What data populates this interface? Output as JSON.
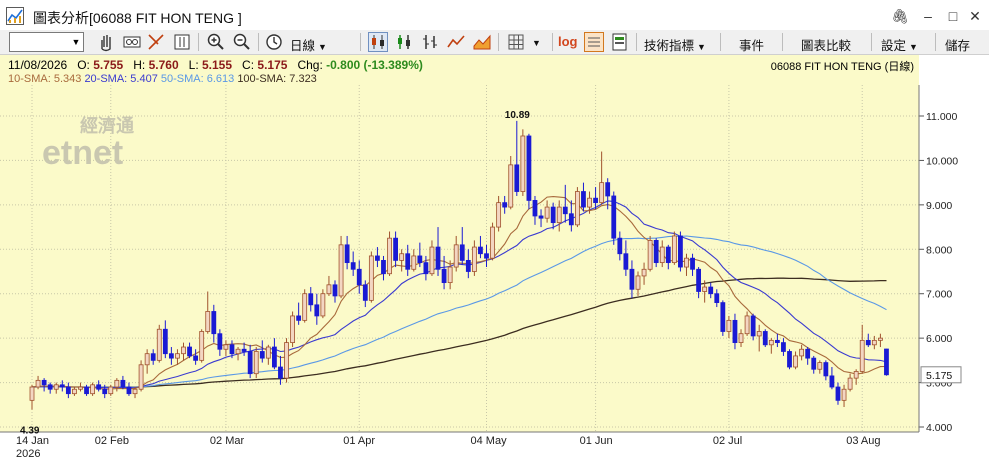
{
  "window": {
    "title": "圖表分析[06088 FIT HON TENG ]",
    "controls": [
      "pin-icon",
      "minimize-icon",
      "restore-icon",
      "close-icon"
    ]
  },
  "toolbar": {
    "period_label": "日線",
    "indicators_label": "技術指標",
    "events_label": "事件",
    "compare_label": "圖表比較",
    "settings_label": "設定",
    "save_label": "儲存",
    "log_label": "log",
    "icons": [
      "hand-icon",
      "crosshair-icon",
      "draw-line-icon",
      "bar-select-icon",
      "zoom-in-icon",
      "zoom-out-icon",
      "clock-icon",
      "candlestick-icon",
      "ohlc-bar-icon",
      "hlc-bar-icon",
      "line-chart-icon",
      "area-chart-icon",
      "grid-icon",
      "log-scale-icon",
      "fit-icon",
      "export-icon"
    ]
  },
  "info": {
    "date": "11/08/2026",
    "o_label": "O:",
    "o": "5.755",
    "h_label": "H:",
    "h": "5.760",
    "l_label": "L:",
    "l": "5.155",
    "c_label": "C:",
    "c": "5.175",
    "chg_label": "Chg:",
    "chg": "-0.800 (-13.389%)",
    "name": "06088  FIT HON TENG (日線)",
    "sma10": "10-SMA: 5.343",
    "sma20": "20-SMA: 5.407",
    "sma50": "50-SMA: 6.613",
    "sma100": "100-SMA: 7.323"
  },
  "colors": {
    "background": "#fbfac9",
    "up": "#f3d6c2",
    "up_border": "#a0522d",
    "down": "#1a1ad4",
    "sma10": "#a86a3c",
    "sma20": "#3a3ad0",
    "sma50": "#5a98e6",
    "sma100": "#3c2d20",
    "chg": "#2e8b1e",
    "price": "#8b1a1a"
  },
  "watermark": {
    "line1": "經濟通",
    "line2": "etnet"
  },
  "chart_data": {
    "type": "candlestick",
    "y_axis": {
      "min": 4.0,
      "max": 11.0,
      "ticks": [
        "4.000",
        "5.000",
        "6.000",
        "7.000",
        "8.000",
        "9.000",
        "10.000",
        "11.000"
      ]
    },
    "x_labels": [
      {
        "label": "14 Jan",
        "sub": "2026",
        "index": 0
      },
      {
        "label": "02 Feb",
        "index": 13
      },
      {
        "label": "02 Mar",
        "index": 32
      },
      {
        "label": "01 Apr",
        "index": 54
      },
      {
        "label": "04 May",
        "index": 75
      },
      {
        "label": "01 Jun",
        "index": 93
      },
      {
        "label": "02 Jul",
        "index": 115
      },
      {
        "label": "03 Aug",
        "index": 137
      }
    ],
    "annotations": [
      {
        "text": "10.89",
        "index": 80,
        "value": 10.89
      },
      {
        "text": "4.39",
        "index": 0,
        "value": 4.39
      }
    ],
    "last_price": "5.175",
    "candles": [
      [
        4.6,
        4.95,
        4.39,
        4.9
      ],
      [
        4.9,
        5.15,
        4.85,
        5.05
      ],
      [
        5.05,
        5.1,
        4.8,
        4.95
      ],
      [
        4.95,
        5.0,
        4.75,
        4.85
      ],
      [
        4.85,
        5.0,
        4.75,
        4.95
      ],
      [
        4.95,
        5.05,
        4.8,
        4.9
      ],
      [
        4.9,
        5.0,
        4.65,
        4.75
      ],
      [
        4.75,
        4.9,
        4.7,
        4.85
      ],
      [
        4.85,
        5.0,
        4.8,
        4.9
      ],
      [
        4.9,
        4.95,
        4.7,
        4.75
      ],
      [
        4.75,
        5.0,
        4.7,
        4.95
      ],
      [
        4.95,
        5.05,
        4.8,
        4.85
      ],
      [
        4.85,
        4.95,
        4.65,
        4.75
      ],
      [
        4.75,
        4.95,
        4.7,
        4.9
      ],
      [
        4.9,
        5.1,
        4.8,
        5.05
      ],
      [
        5.05,
        5.15,
        4.85,
        4.9
      ],
      [
        4.9,
        5.0,
        4.7,
        4.75
      ],
      [
        4.75,
        4.9,
        4.65,
        4.85
      ],
      [
        4.85,
        5.5,
        4.8,
        5.4
      ],
      [
        5.4,
        5.75,
        5.2,
        5.65
      ],
      [
        5.65,
        5.75,
        5.4,
        5.5
      ],
      [
        5.5,
        6.3,
        5.45,
        6.2
      ],
      [
        6.2,
        6.4,
        5.55,
        5.65
      ],
      [
        5.65,
        5.8,
        5.4,
        5.55
      ],
      [
        5.55,
        5.75,
        5.4,
        5.65
      ],
      [
        5.65,
        5.9,
        5.5,
        5.8
      ],
      [
        5.8,
        5.9,
        5.55,
        5.6
      ],
      [
        5.6,
        5.75,
        5.4,
        5.5
      ],
      [
        5.5,
        6.2,
        5.45,
        6.15
      ],
      [
        6.15,
        7.05,
        6.1,
        6.6
      ],
      [
        6.6,
        6.75,
        5.9,
        6.1
      ],
      [
        6.1,
        6.2,
        5.6,
        5.75
      ],
      [
        5.75,
        5.95,
        5.6,
        5.85
      ],
      [
        5.85,
        5.95,
        5.55,
        5.65
      ],
      [
        5.65,
        5.8,
        5.5,
        5.75
      ],
      [
        5.75,
        5.9,
        5.6,
        5.7
      ],
      [
        5.7,
        5.85,
        5.1,
        5.2
      ],
      [
        5.2,
        5.8,
        5.1,
        5.7
      ],
      [
        5.7,
        5.95,
        5.45,
        5.55
      ],
      [
        5.55,
        5.85,
        5.4,
        5.8
      ],
      [
        5.8,
        6.0,
        5.3,
        5.35
      ],
      [
        5.35,
        5.6,
        4.95,
        5.1
      ],
      [
        5.1,
        6.0,
        5.0,
        5.9
      ],
      [
        5.9,
        6.6,
        5.8,
        6.5
      ],
      [
        6.5,
        6.8,
        6.3,
        6.4
      ],
      [
        6.4,
        7.1,
        6.35,
        7.0
      ],
      [
        7.0,
        7.15,
        6.6,
        6.75
      ],
      [
        6.75,
        7.0,
        6.3,
        6.5
      ],
      [
        6.5,
        7.1,
        6.45,
        7.0
      ],
      [
        7.0,
        7.4,
        6.95,
        7.2
      ],
      [
        7.2,
        7.3,
        6.8,
        6.95
      ],
      [
        6.95,
        8.3,
        6.9,
        8.1
      ],
      [
        8.1,
        8.3,
        7.55,
        7.7
      ],
      [
        7.7,
        7.95,
        7.4,
        7.55
      ],
      [
        7.55,
        7.75,
        7.0,
        7.2
      ],
      [
        7.2,
        7.3,
        6.7,
        6.85
      ],
      [
        6.85,
        7.95,
        6.8,
        7.85
      ],
      [
        7.85,
        8.05,
        7.6,
        7.75
      ],
      [
        7.75,
        7.85,
        7.3,
        7.45
      ],
      [
        7.45,
        8.4,
        7.4,
        8.25
      ],
      [
        8.25,
        8.4,
        7.6,
        7.75
      ],
      [
        7.75,
        8.0,
        7.5,
        7.9
      ],
      [
        7.9,
        8.1,
        7.4,
        7.55
      ],
      [
        7.55,
        8.0,
        7.5,
        7.85
      ],
      [
        7.85,
        8.15,
        7.6,
        7.7
      ],
      [
        7.7,
        7.85,
        7.3,
        7.45
      ],
      [
        7.45,
        8.2,
        7.4,
        8.05
      ],
      [
        8.05,
        8.5,
        7.4,
        7.55
      ],
      [
        7.55,
        7.85,
        7.1,
        7.25
      ],
      [
        7.25,
        7.75,
        7.1,
        7.6
      ],
      [
        7.6,
        8.3,
        7.5,
        8.1
      ],
      [
        8.1,
        8.5,
        7.65,
        7.75
      ],
      [
        7.75,
        8.0,
        7.35,
        7.5
      ],
      [
        7.5,
        8.2,
        7.4,
        8.05
      ],
      [
        8.05,
        8.3,
        7.8,
        7.9
      ],
      [
        7.9,
        8.1,
        7.6,
        7.8
      ],
      [
        7.8,
        8.6,
        7.75,
        8.5
      ],
      [
        8.5,
        9.2,
        8.4,
        9.05
      ],
      [
        9.05,
        9.2,
        8.8,
        8.95
      ],
      [
        8.95,
        10.1,
        8.9,
        9.9
      ],
      [
        9.9,
        10.89,
        9.2,
        9.3
      ],
      [
        9.3,
        10.7,
        9.2,
        10.55
      ],
      [
        10.55,
        10.6,
        8.9,
        9.1
      ],
      [
        9.1,
        9.2,
        8.55,
        8.75
      ],
      [
        8.75,
        8.9,
        8.5,
        8.7
      ],
      [
        8.7,
        9.1,
        8.6,
        8.95
      ],
      [
        8.95,
        9.05,
        8.45,
        8.6
      ],
      [
        8.6,
        9.1,
        8.4,
        8.95
      ],
      [
        8.95,
        9.45,
        8.6,
        8.8
      ],
      [
        8.8,
        9.1,
        8.4,
        8.55
      ],
      [
        8.55,
        9.4,
        8.5,
        9.3
      ],
      [
        9.3,
        9.5,
        8.85,
        8.95
      ],
      [
        8.95,
        9.3,
        8.8,
        9.15
      ],
      [
        9.15,
        9.4,
        8.9,
        9.05
      ],
      [
        9.05,
        10.2,
        9.0,
        9.5
      ],
      [
        9.5,
        9.6,
        8.9,
        9.2
      ],
      [
        9.2,
        9.3,
        8.1,
        8.25
      ],
      [
        8.25,
        8.4,
        7.75,
        7.9
      ],
      [
        7.9,
        8.2,
        7.4,
        7.55
      ],
      [
        7.55,
        7.75,
        6.9,
        7.1
      ],
      [
        7.1,
        7.5,
        6.95,
        7.4
      ],
      [
        7.4,
        7.7,
        7.2,
        7.55
      ],
      [
        7.55,
        8.3,
        7.5,
        8.2
      ],
      [
        8.2,
        8.25,
        7.6,
        7.7
      ],
      [
        7.7,
        8.2,
        7.6,
        8.05
      ],
      [
        8.05,
        8.1,
        7.55,
        7.7
      ],
      [
        7.7,
        8.4,
        7.65,
        8.3
      ],
      [
        8.3,
        8.4,
        7.5,
        7.6
      ],
      [
        7.6,
        7.9,
        7.4,
        7.8
      ],
      [
        7.8,
        7.9,
        7.4,
        7.55
      ],
      [
        7.55,
        7.6,
        6.9,
        7.05
      ],
      [
        7.05,
        7.3,
        6.8,
        7.15
      ],
      [
        7.15,
        7.25,
        6.9,
        7.0
      ],
      [
        7.0,
        7.1,
        6.7,
        6.8
      ],
      [
        6.8,
        6.85,
        6.05,
        6.15
      ],
      [
        6.15,
        6.5,
        6.0,
        6.4
      ],
      [
        6.4,
        6.55,
        5.75,
        5.9
      ],
      [
        5.9,
        6.2,
        5.8,
        6.1
      ],
      [
        6.1,
        6.6,
        6.05,
        6.5
      ],
      [
        6.5,
        6.55,
        5.95,
        6.05
      ],
      [
        6.05,
        6.3,
        5.7,
        6.15
      ],
      [
        6.15,
        6.2,
        5.8,
        5.85
      ],
      [
        5.85,
        6.0,
        5.65,
        5.95
      ],
      [
        5.95,
        6.1,
        5.8,
        5.9
      ],
      [
        5.9,
        6.0,
        5.6,
        5.7
      ],
      [
        5.7,
        5.75,
        5.3,
        5.35
      ],
      [
        5.35,
        5.7,
        5.3,
        5.6
      ],
      [
        5.6,
        5.85,
        5.5,
        5.75
      ],
      [
        5.75,
        5.8,
        5.4,
        5.55
      ],
      [
        5.55,
        5.6,
        5.2,
        5.3
      ],
      [
        5.3,
        5.5,
        5.2,
        5.45
      ],
      [
        5.45,
        5.5,
        5.05,
        5.15
      ],
      [
        5.15,
        5.35,
        4.85,
        4.9
      ],
      [
        4.9,
        5.0,
        4.5,
        4.6
      ],
      [
        4.6,
        4.95,
        4.45,
        4.85
      ],
      [
        4.85,
        5.2,
        4.8,
        5.1
      ],
      [
        5.1,
        5.3,
        4.95,
        5.25
      ],
      [
        5.25,
        6.3,
        5.2,
        5.95
      ],
      [
        5.95,
        6.1,
        5.8,
        5.85
      ],
      [
        5.85,
        6.05,
        5.75,
        5.95
      ],
      [
        5.95,
        6.1,
        5.8,
        6.0
      ],
      [
        5.755,
        5.76,
        5.155,
        5.175
      ]
    ],
    "series": [
      {
        "name": "10-SMA",
        "key": "sma10",
        "values": []
      },
      {
        "name": "20-SMA",
        "key": "sma20",
        "values": []
      },
      {
        "name": "50-SMA",
        "key": "sma50",
        "values": []
      },
      {
        "name": "100-SMA",
        "key": "sma100",
        "values": []
      }
    ]
  }
}
